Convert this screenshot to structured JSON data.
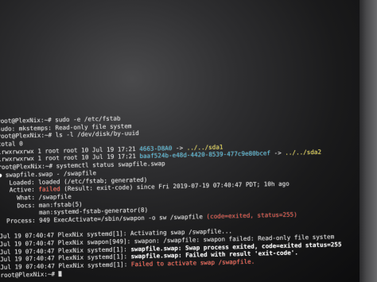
{
  "terminal": {
    "lines": [
      {
        "segments": [
          {
            "text": "root@PlexNix:~# sudo -e /etc/fstab",
            "cls": ""
          }
        ]
      },
      {
        "segments": [
          {
            "text": "sudo: mkstemps: Read-only file system",
            "cls": ""
          }
        ]
      },
      {
        "segments": [
          {
            "text": "root@PlexNix:~# ls -l /dev/disk/by-uuid",
            "cls": ""
          }
        ]
      },
      {
        "segments": [
          {
            "text": "total 0",
            "cls": ""
          }
        ]
      },
      {
        "segments": [
          {
            "text": "lrwxrwxrwx 1 root root 10 Jul 19 17:21 ",
            "cls": ""
          },
          {
            "text": "4663-D8A0",
            "cls": "cyan"
          },
          {
            "text": " -> ",
            "cls": ""
          },
          {
            "text": "../../sda1",
            "cls": "yellow"
          }
        ]
      },
      {
        "segments": [
          {
            "text": "lrwxrwxrwx 1 root root 10 Jul 19 17:21 ",
            "cls": ""
          },
          {
            "text": "baaf524b-e48d-4420-8539-477c9e80bcef",
            "cls": "cyan"
          },
          {
            "text": " -> ",
            "cls": ""
          },
          {
            "text": "../../sda2",
            "cls": "yellow"
          }
        ]
      },
      {
        "segments": [
          {
            "text": "root@PlexNix:~# systemctl status swapfile.swap",
            "cls": ""
          }
        ]
      },
      {
        "segments": [
          {
            "text": "● ",
            "cls": "dot"
          },
          {
            "text": "swapfile.swap - /swapfile",
            "cls": ""
          }
        ]
      },
      {
        "segments": [
          {
            "text": "   Loaded: loaded (/etc/fstab; generated)",
            "cls": ""
          }
        ]
      },
      {
        "segments": [
          {
            "text": "   Active: ",
            "cls": ""
          },
          {
            "text": "failed",
            "cls": "redbright"
          },
          {
            "text": " (Result: exit-code) since Fri 2019-07-19 07:40:47 PDT; 10h ago",
            "cls": ""
          }
        ]
      },
      {
        "segments": [
          {
            "text": "     What: /swapfile",
            "cls": ""
          }
        ]
      },
      {
        "segments": [
          {
            "text": "     Docs: man:fstab(5)",
            "cls": ""
          }
        ]
      },
      {
        "segments": [
          {
            "text": "           man:systemd-fstab-generator(8)",
            "cls": ""
          }
        ]
      },
      {
        "segments": [
          {
            "text": "  Process: 949 ExecActivate=/sbin/swapon -o sw /swapfile ",
            "cls": ""
          },
          {
            "text": "(code=exited, status=255)",
            "cls": "red"
          }
        ]
      },
      {
        "segments": [
          {
            "text": " ",
            "cls": ""
          }
        ]
      },
      {
        "segments": [
          {
            "text": "Jul 19 07:40:47 PlexNix systemd[1]: Activating swap /swapfile...",
            "cls": ""
          }
        ]
      },
      {
        "segments": [
          {
            "text": "Jul 19 07:40:47 PlexNix swapon[949]: swapon: /swapfile: swapon failed: Read-only file system",
            "cls": ""
          }
        ]
      },
      {
        "segments": [
          {
            "text": "Jul 19 07:40:47 PlexNix systemd[1]: ",
            "cls": ""
          },
          {
            "text": "swapfile.swap: Swap process exited, code=exited status=255",
            "cls": "white"
          }
        ]
      },
      {
        "segments": [
          {
            "text": "Jul 19 07:40:47 PlexNix systemd[1]: ",
            "cls": ""
          },
          {
            "text": "swapfile.swap: Failed with result 'exit-code'.",
            "cls": "white"
          }
        ]
      },
      {
        "segments": [
          {
            "text": "Jul 19 07:40:47 PlexNix systemd[1]: ",
            "cls": ""
          },
          {
            "text": "Failed to activate swap /swapfile.",
            "cls": "redbright"
          }
        ]
      },
      {
        "segments": [
          {
            "text": "root@PlexNix:~# ",
            "cls": ""
          }
        ],
        "cursor": true
      }
    ]
  }
}
